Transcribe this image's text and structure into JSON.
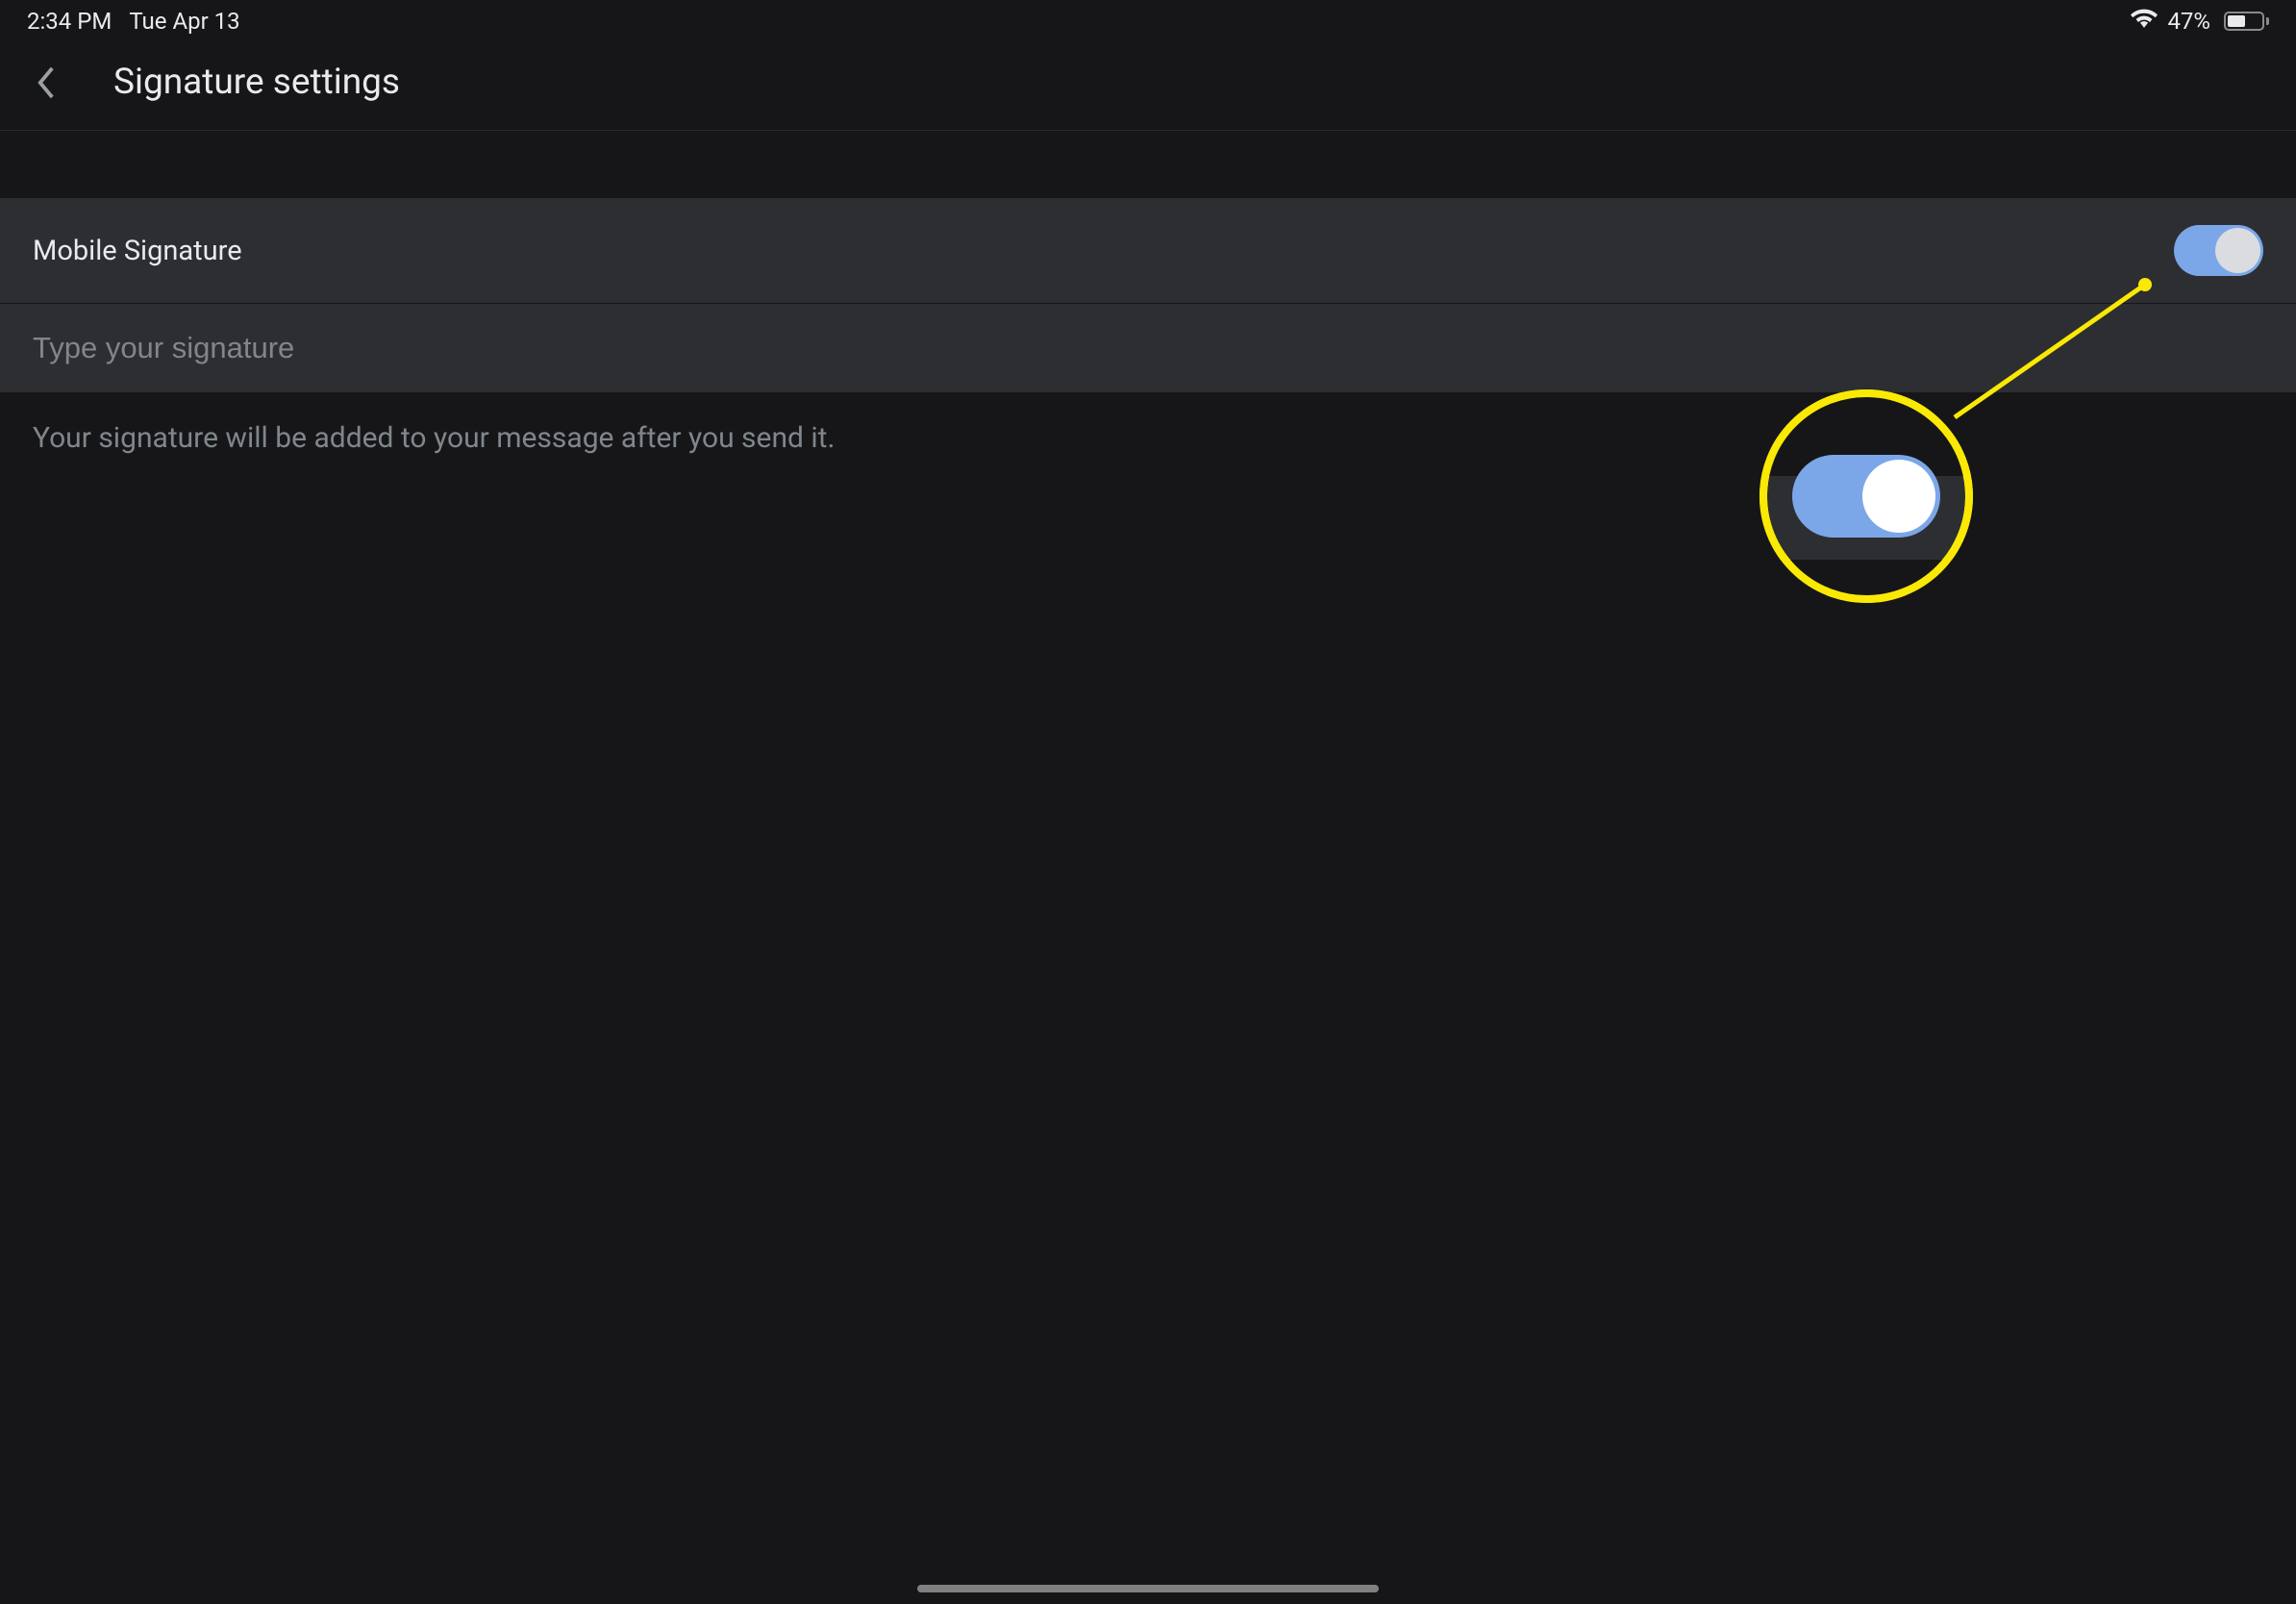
{
  "status_bar": {
    "time": "2:34 PM",
    "date": "Tue Apr 13",
    "battery_percent": "47%"
  },
  "header": {
    "title": "Signature settings"
  },
  "settings": {
    "mobile_signature_label": "Mobile Signature",
    "signature_placeholder": "Type your signature",
    "signature_value": "",
    "description_text": "Your signature will be added to your message after you send it."
  }
}
